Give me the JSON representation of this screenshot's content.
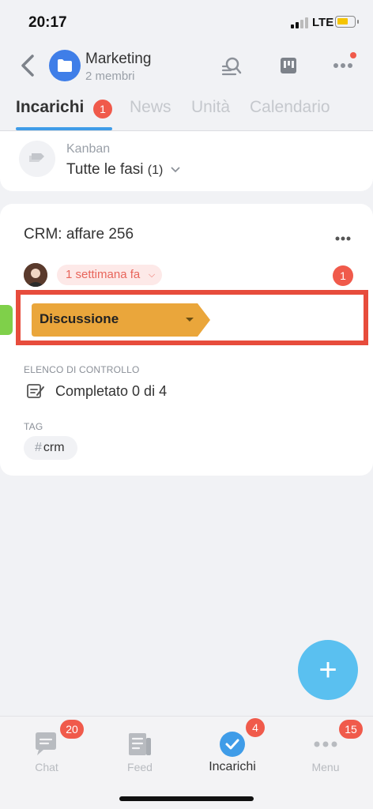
{
  "status_bar": {
    "time": "20:17",
    "network": "LTE"
  },
  "header": {
    "title": "Marketing",
    "subtitle": "2 membri"
  },
  "tabs": [
    {
      "label": "Incarichi",
      "badge": "1",
      "active": true
    },
    {
      "label": "News"
    },
    {
      "label": "Unità"
    },
    {
      "label": "Calendario"
    }
  ],
  "kanban": {
    "label": "Kanban",
    "value": "Tutte le fasi",
    "count": "(1)"
  },
  "task": {
    "title": "CRM: affare 256",
    "time_ago": "1 settimana fa",
    "counter": "1",
    "stage": "Discussione",
    "checklist_label": "ELENCO DI CONTROLLO",
    "checklist_value": "Completato 0 di 4",
    "tag_label": "TAG",
    "tag_hash": "#",
    "tag_value": "crm"
  },
  "colors": {
    "accent": "#3f9ce8",
    "badge": "#f05a4b",
    "stage": "#eaa63b",
    "stage_left": "#7fd04a",
    "fab": "#5ac0f0",
    "highlight": "#e74c3c"
  },
  "tabbar": [
    {
      "label": "Chat",
      "badge": "20",
      "icon": "chat-icon"
    },
    {
      "label": "Feed",
      "icon": "feed-icon"
    },
    {
      "label": "Incarichi",
      "badge": "4",
      "icon": "check-icon",
      "active": true
    },
    {
      "label": "Menu",
      "badge": "15",
      "icon": "more-icon"
    }
  ],
  "fab": {
    "icon": "plus-icon",
    "symbol": "+"
  }
}
